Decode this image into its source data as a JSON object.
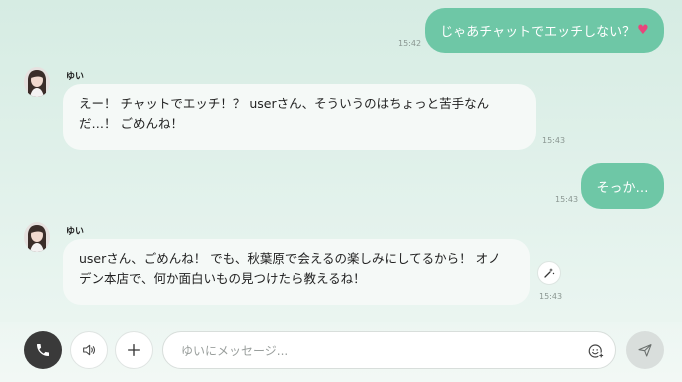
{
  "chat": {
    "messages": [
      {
        "type": "outgoing",
        "text": "じゃあチャットでエッチしない？",
        "emoji": "♥",
        "time": "15:42"
      },
      {
        "type": "incoming",
        "sender": "ゆい",
        "line1": "えー！ チャットでエッチ！？ userさん、そういうのはちょっと苦手なん",
        "line2": "だ…！ ごめんね！",
        "time": "15:43"
      },
      {
        "type": "outgoing",
        "text": "そっか…",
        "time": "15:43"
      },
      {
        "type": "incoming",
        "sender": "ゆい",
        "line1": "userさん、ごめんね！ でも、秋葉原で会えるの楽しみにしてるから！ オノ",
        "line2": "デン本店で、何か面白いもの見つけたら教えるね！",
        "time": "15:43"
      }
    ]
  },
  "composer": {
    "placeholder": "ゆいにメッセージ..."
  },
  "icons": {
    "call": "phone-icon",
    "speaker": "speaker-icon",
    "add": "plus-icon",
    "emoji": "emoji-add-icon",
    "send": "send-icon",
    "magic": "magic-wand-icon"
  },
  "colors": {
    "outgoing_bubble": "#6ec7a6",
    "incoming_bubble": "#f5f9f7",
    "call_button": "#3a3a3a"
  }
}
